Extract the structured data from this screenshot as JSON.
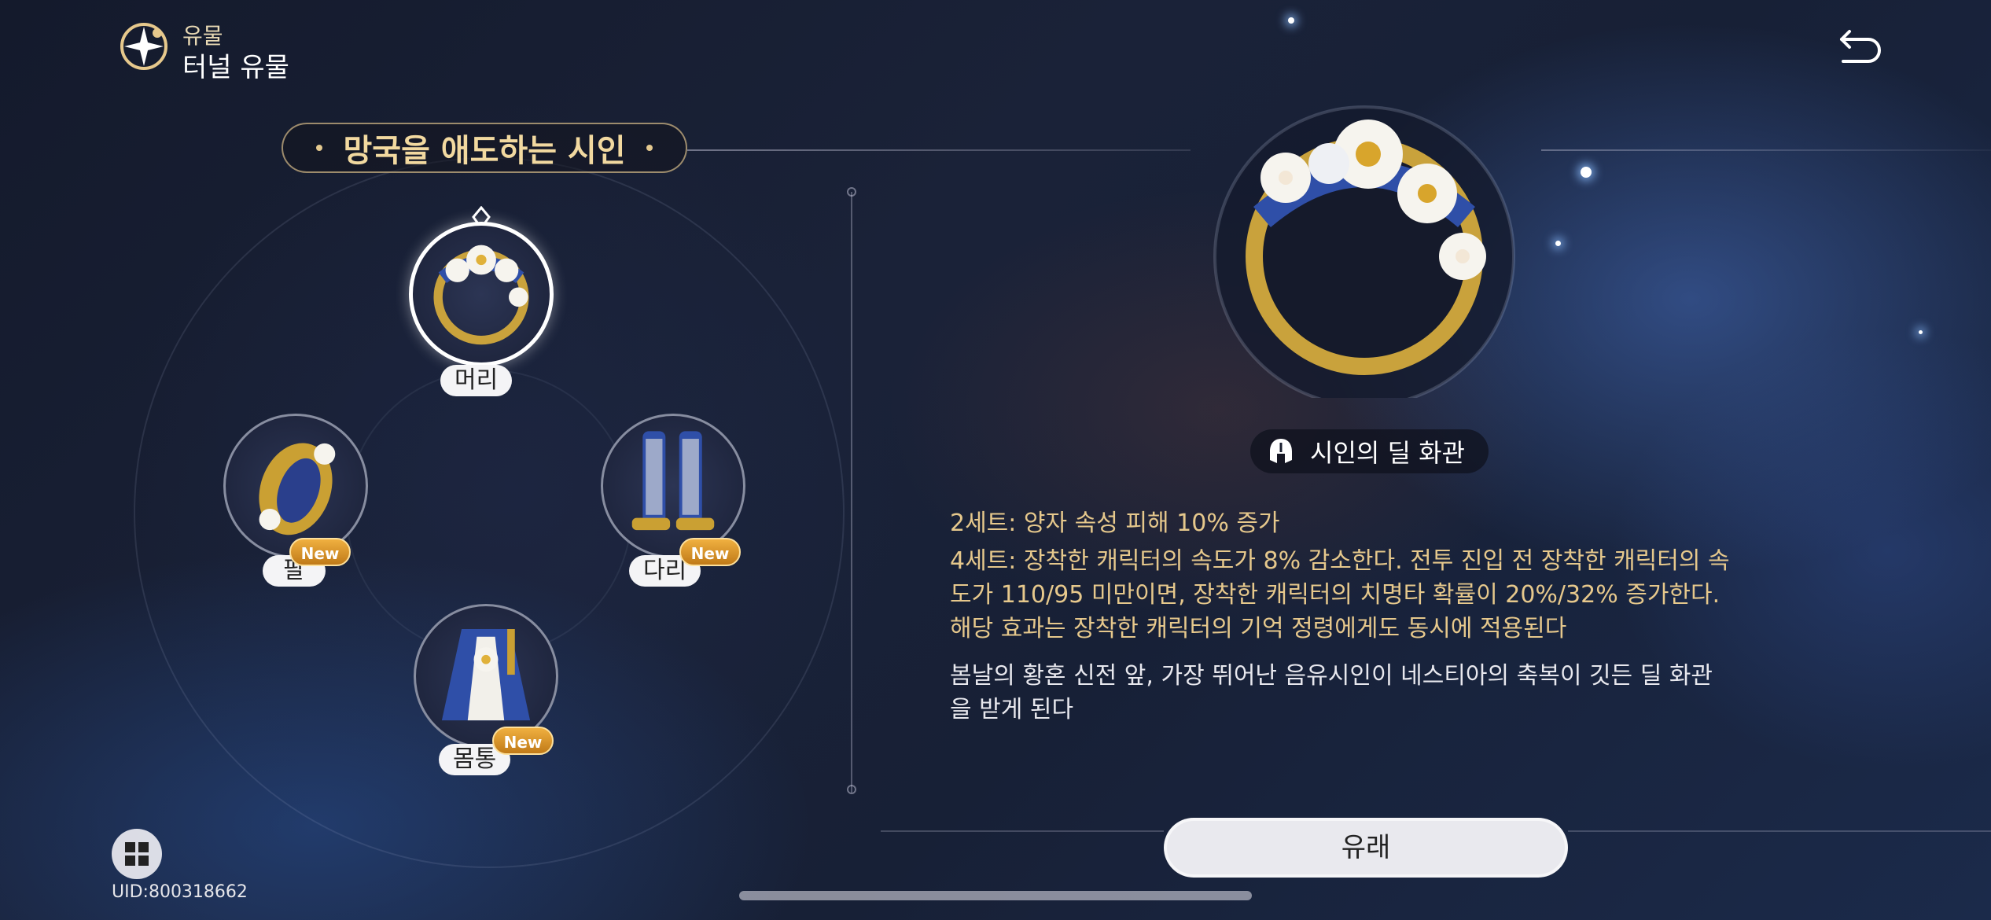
{
  "header": {
    "category": "유물",
    "title": "터널 유물",
    "back_icon": "back-arrow-icon",
    "app_icon": "relic-compass-icon"
  },
  "set": {
    "name": "망국을 애도하는 시인"
  },
  "slots": [
    {
      "label": "머리",
      "icon": "flower-crown-icon",
      "selected": true,
      "new": false
    },
    {
      "label": "팔",
      "icon": "gold-bracelet-icon",
      "selected": false,
      "new": true
    },
    {
      "label": "다리",
      "icon": "blue-boots-icon",
      "selected": false,
      "new": true
    },
    {
      "label": "몸통",
      "icon": "blue-robe-icon",
      "selected": false,
      "new": true
    }
  ],
  "badge_text": "New",
  "detail": {
    "relic_name": "시인의 딜 화관",
    "relic_type_icon": "helmet-icon",
    "set2": "2세트: 양자 속성 피해 10% 증가",
    "set4_line1": "4세트: 장착한 캐릭터의 속도가 8% 감소한다. 전투 진입 전 장착한 캐릭터의 속",
    "set4_line2": "도가 110/95 미만이면, 장착한 캐릭터의 치명타 확률이 20%/32% 증가한다.",
    "set4_line3": "해당 효과는 장착한 캐릭터의 기억 정령에게도 동시에 적용된다",
    "lore_line1": "봄날의 황혼 신전 앞, 가장 뛰어난 음유시인이 네스티아의 축복이 깃든 딜 화관",
    "lore_line2": "을 받게 된다"
  },
  "footer": {
    "origin_button": "유래",
    "uid": "UID:800318662",
    "menu_icon": "grid-menu-icon"
  },
  "colors": {
    "accent_gold": "#e6c88c",
    "title_gold": "#f2d9a0",
    "badge_orange": "#f0b040"
  }
}
